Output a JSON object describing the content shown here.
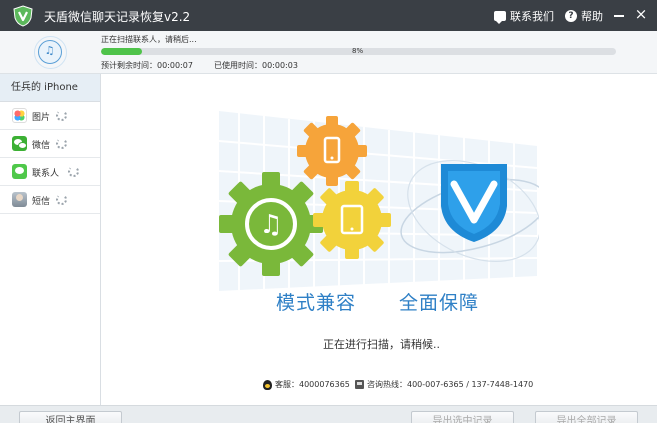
{
  "window": {
    "title": "天盾微信聊天记录恢复v2.2",
    "contact_label": "联系我们",
    "help_label": "帮助",
    "close_glyph": "×"
  },
  "progress": {
    "status_text": "正在扫描联系人，请稍后...",
    "percent_label": "8%",
    "percent": 8,
    "time_left": "预计剩余时间：00:00:07",
    "time_used": "已使用时间：00:00:03",
    "device_icon": "music-note-icon"
  },
  "sidebar": {
    "device_name": "任兵的 iPhone",
    "items": [
      {
        "label": "图片",
        "icon": "photos-icon"
      },
      {
        "label": "微信",
        "icon": "wechat-icon"
      },
      {
        "label": "联系人",
        "icon": "contacts-icon"
      },
      {
        "label": "短信",
        "icon": "sms-icon"
      }
    ]
  },
  "main": {
    "slogan_left": "模式兼容",
    "slogan_right": "全面保障",
    "scanning_message": "正在进行扫描，请稍候..",
    "support_text": "客服：4000076365",
    "hotline_text": "咨询热线：400-007-6365 / 137-7448-1470"
  },
  "footer": {
    "back_label": "返回主界面",
    "export_selected_label": "导出选中记录",
    "export_all_label": "导出全部记录"
  },
  "colors": {
    "titlebar": "#3a3f45",
    "progress_fill": "#4fc34a",
    "accent_blue": "#2f80c6",
    "gear_green": "#7ab83a",
    "gear_orange": "#f6a43a",
    "gear_yellow": "#f2d23b"
  }
}
